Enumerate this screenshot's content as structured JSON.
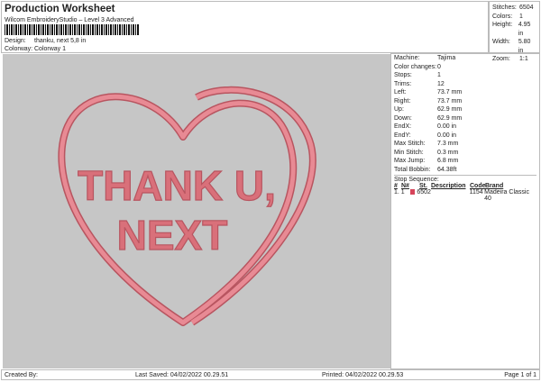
{
  "header": {
    "title": "Production Worksheet",
    "subtitle": "Wilcom EmbroideryStudio – Level 3 Advanced",
    "design_label": "Design:",
    "design": "thanku, next 5,8 in",
    "colorway_label": "Colorway:",
    "colorway": "Colorway 1"
  },
  "stats": [
    {
      "k": "Stitches:",
      "v": "6504"
    },
    {
      "k": "Colors:",
      "v": "1"
    },
    {
      "k": "Height:",
      "v": "4.95 in"
    },
    {
      "k": "Width:",
      "v": "5.80 in"
    },
    {
      "k": "Zoom:",
      "v": "1:1"
    }
  ],
  "design_text": {
    "line1": "THANK U,",
    "line2": "NEXT"
  },
  "colors": {
    "thread": "#d9707a",
    "canvas": "#c6c6c6"
  },
  "details": [
    {
      "k": "Machine:",
      "v": "Tajima"
    },
    {
      "k": "Color changes:",
      "v": "0"
    },
    {
      "k": "Stops:",
      "v": "1"
    },
    {
      "k": "Trims:",
      "v": "12"
    },
    {
      "k": "Left:",
      "v": "73.7 mm"
    },
    {
      "k": "Right:",
      "v": "73.7 mm"
    },
    {
      "k": "Up:",
      "v": "62.9 mm"
    },
    {
      "k": "Down:",
      "v": "62.9 mm"
    },
    {
      "k": "EndX:",
      "v": "0.00 in"
    },
    {
      "k": "EndY:",
      "v": "0.00 in"
    },
    {
      "k": "Max Stitch:",
      "v": "7.3 mm"
    },
    {
      "k": "Min Stitch:",
      "v": "0.3 mm"
    },
    {
      "k": "Max Jump:",
      "v": "6.8 mm"
    },
    {
      "k": "Total Bobbin:",
      "v": "64.38ft"
    }
  ],
  "stop_sequence": {
    "label": "Stop Sequence:",
    "headers": [
      "#",
      "N#",
      "St.",
      "Description",
      "Code",
      "Brand"
    ],
    "rows": [
      {
        "num": "1.",
        "n": "1",
        "st": "6502",
        "desc": "",
        "code": "1154",
        "brand": "Madeira Classic 40"
      }
    ]
  },
  "footer": {
    "created": "Created By:",
    "saved": "Last Saved: 04/02/2022 00.29.51",
    "printed": "Printed: 04/02/2022 00.29.53",
    "page": "Page 1 of 1"
  }
}
